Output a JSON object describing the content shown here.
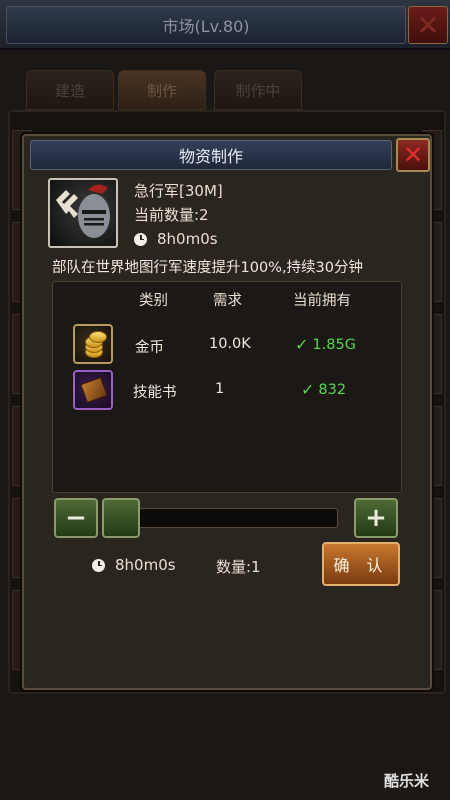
{
  "header": {
    "title": "市场(Lv.80)"
  },
  "tabs": [
    {
      "label": "建造"
    },
    {
      "label": "制作"
    },
    {
      "label": "制作中"
    }
  ],
  "dialog": {
    "title": "物资制作",
    "item": {
      "name": "急行军[30M]",
      "quantity_label": "当前数量:2",
      "time": "8h0m0s",
      "description": "部队在世界地图行军速度提升100%,持续30分钟"
    },
    "requirements": {
      "headers": {
        "type": "类别",
        "need": "需求",
        "have": "当前拥有"
      },
      "rows": [
        {
          "icon": "gold-coins-icon",
          "name": "金币",
          "need": "10.0K",
          "have": "1.85G"
        },
        {
          "icon": "skill-book-icon",
          "name": "技能书",
          "need": "1",
          "have": "832"
        }
      ]
    },
    "controls": {
      "minus_label": "−",
      "plus_label": "+",
      "slider_value": 0
    },
    "footer": {
      "time": "8h0m0s",
      "quantity": "数量:1",
      "confirm": "确 认"
    }
  },
  "watermark": "酷乐米",
  "colors": {
    "accent_green": "#58d64c",
    "confirm_orange": "#c9782e",
    "close_red": "#e0302a"
  }
}
